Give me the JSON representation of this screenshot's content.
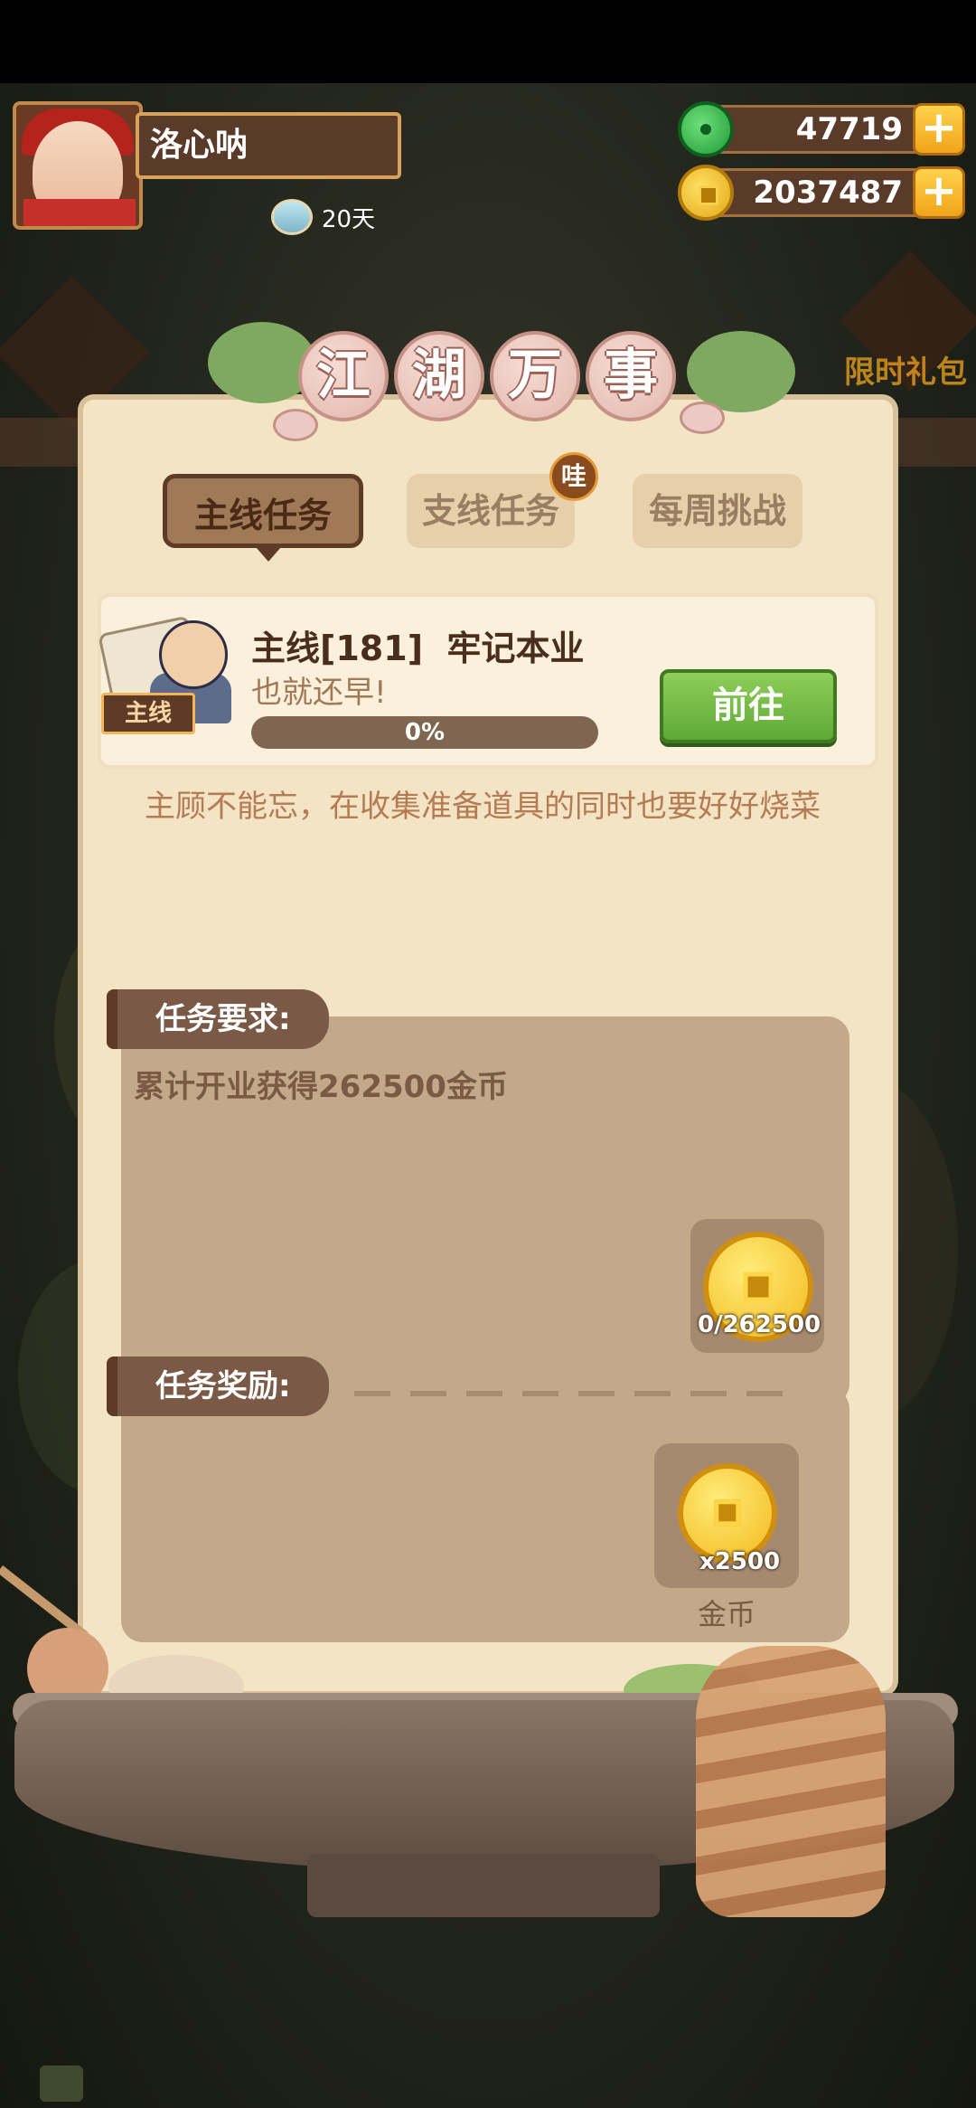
{
  "player": {
    "name": "洛心呐",
    "days": "20天"
  },
  "resources": {
    "jade": "47719",
    "coins": "2037487",
    "plus": "+"
  },
  "side": {
    "right_label": "限时礼包"
  },
  "panel": {
    "title_chars": [
      "江",
      "湖",
      "万",
      "事"
    ],
    "tabs": {
      "main": "主线任务",
      "side": "支线任务",
      "weekly": "每周挑战",
      "badge": "哇"
    },
    "quest": {
      "tag": "主线",
      "title": "主线[181]  牢记本业",
      "subtitle": "也就还早!",
      "progress_percent": 0,
      "progress_label": "0%",
      "go_button": "前往",
      "description": "主顾不能忘，在收集准备道具的同时也要好好烧菜"
    },
    "requirement": {
      "header": "任务要求:",
      "text": "累计开业获得262500金币",
      "item_count": "0/262500"
    },
    "reward": {
      "header": "任务奖励:",
      "item_count": "x2500",
      "item_name": "金币"
    }
  },
  "colors": {
    "accent_green": "#5fa935",
    "coin_gold": "#f3b91c",
    "panel_bg": "#f3e4c6",
    "brown": "#5d3b26"
  }
}
